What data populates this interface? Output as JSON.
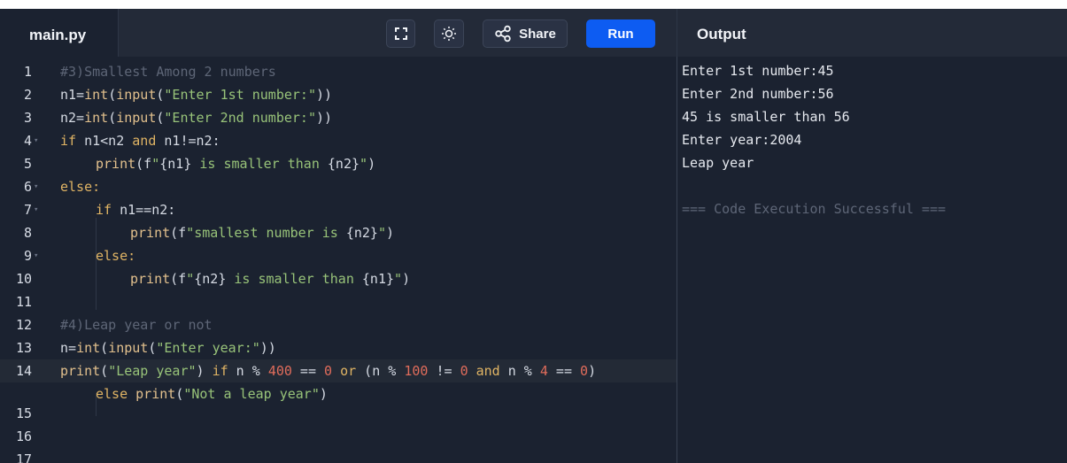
{
  "header": {
    "filename": "main.py",
    "share_label": "Share",
    "run_label": "Run",
    "output_label": "Output"
  },
  "editor": {
    "lines": [
      {
        "num": "1"
      },
      {
        "num": "2"
      },
      {
        "num": "3"
      },
      {
        "num": "4"
      },
      {
        "num": "5"
      },
      {
        "num": "6"
      },
      {
        "num": "7"
      },
      {
        "num": "8"
      },
      {
        "num": "9"
      },
      {
        "num": "10"
      },
      {
        "num": "11"
      },
      {
        "num": "12"
      },
      {
        "num": "13"
      },
      {
        "num": "14"
      },
      {
        "num": "15"
      },
      {
        "num": "16"
      },
      {
        "num": "17"
      }
    ],
    "code": {
      "l1": "#3)Smallest Among 2 numbers",
      "l2a": "n1=",
      "l2b": "int",
      "l2c": "(",
      "l2d": "input",
      "l2e": "(",
      "l2f": "\"Enter 1st number:\"",
      "l2g": "))",
      "l3a": "n2=",
      "l3b": "int",
      "l3c": "(",
      "l3d": "input",
      "l3e": "(",
      "l3f": "\"Enter 2nd number:\"",
      "l3g": "))",
      "l4a": "if",
      "l4b": " n1<n2 ",
      "l4c": "and",
      "l4d": " n1!=n2:",
      "l5a": "print",
      "l5b": "(f",
      "l5c": "\"",
      "l5d": "{n1}",
      "l5e": " is smaller than ",
      "l5f": "{n2}",
      "l5g": "\"",
      "l5h": ")",
      "l6": "else:",
      "l7a": "if",
      "l7b": " n1==n2:",
      "l8a": "print",
      "l8b": "(f",
      "l8c": "\"smallest number is ",
      "l8d": "{n2}",
      "l8e": "\"",
      "l8f": ")",
      "l9": "else:",
      "l10a": "print",
      "l10b": "(f",
      "l10c": "\"",
      "l10d": "{n2}",
      "l10e": " is smaller than ",
      "l10f": "{n1}",
      "l10g": "\"",
      "l10h": ")",
      "l12": "#4)Leap year or not",
      "l13a": "n=",
      "l13b": "int",
      "l13c": "(",
      "l13d": "input",
      "l13e": "(",
      "l13f": "\"Enter year:\"",
      "l13g": "))",
      "l14a": "print",
      "l14b": "(",
      "l14c": "\"Leap year\"",
      "l14d": ") ",
      "l14e": "if",
      "l14f": " n % ",
      "l14g": "400",
      "l14h": " == ",
      "l14i": "0",
      "l14j": " ",
      "l14k": "or",
      "l14l": " (n % ",
      "l14m": "100",
      "l14n": " != ",
      "l14o": "0",
      "l14p": " ",
      "l14q": "and",
      "l14r": " n % ",
      "l14s": "4",
      "l14t": " == ",
      "l14u": "0",
      "l14v": ")",
      "l14w1": "else",
      "l14w2": " ",
      "l14w3": "print",
      "l14w4": "(",
      "l14w5": "\"Not a leap year\"",
      "l14w6": ")"
    }
  },
  "output": {
    "lines": [
      "Enter 1st number:45",
      "Enter 2nd number:56",
      "45 is smaller than 56",
      "Enter year:2004",
      "Leap year",
      "",
      "=== Code Execution Successful ==="
    ]
  }
}
